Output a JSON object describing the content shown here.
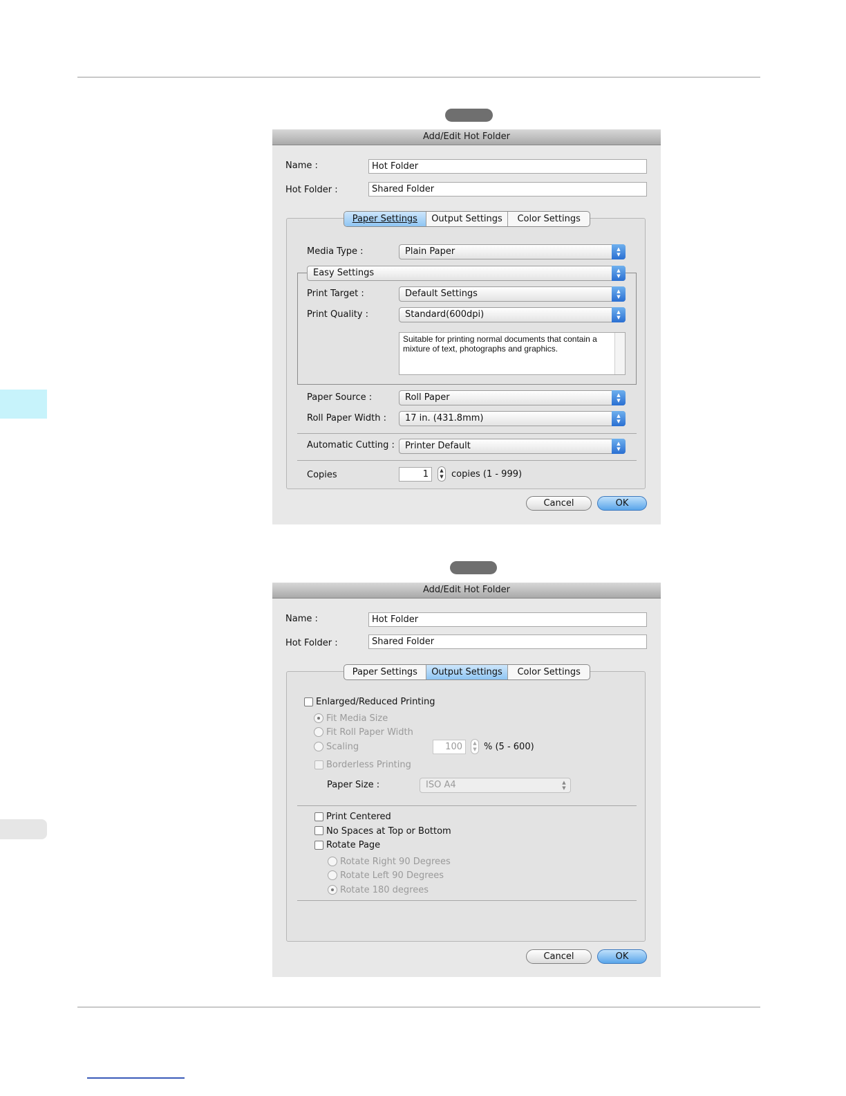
{
  "page": {
    "colors": {
      "rule": "#9a9a9a",
      "side_tab_top": "#c7f3fb",
      "side_tab_bottom": "#e6e6e6",
      "footer_link": "#3a5bb8",
      "pill": "#6f6f6f"
    }
  },
  "dialog1": {
    "title": "Add/Edit Hot Folder",
    "name_label": "Name :",
    "name_value": "Hot Folder",
    "hotfolder_label": "Hot Folder :",
    "hotfolder_value": "Shared Folder",
    "tabs": [
      "Paper Settings",
      "Output Settings",
      "Color Settings"
    ],
    "active_tab": "Paper Settings",
    "media_type_label": "Media Type :",
    "media_type_value": "Plain Paper",
    "easy_settings": "Easy Settings",
    "print_target_label": "Print Target :",
    "print_target_value": "Default Settings",
    "print_quality_label": "Print Quality :",
    "print_quality_value": "Standard(600dpi)",
    "description": "Suitable for printing normal documents that contain a mixture of text, photographs and graphics.",
    "paper_source_label": "Paper Source :",
    "paper_source_value": "Roll Paper",
    "roll_width_label": "Roll Paper Width :",
    "roll_width_value": "17 in. (431.8mm)",
    "auto_cut_label": "Automatic Cutting :",
    "auto_cut_value": "Printer Default",
    "copies_label": "Copies",
    "copies_value": "1",
    "copies_range": "copies (1 - 999)",
    "cancel": "Cancel",
    "ok": "OK"
  },
  "dialog2": {
    "title": "Add/Edit Hot Folder",
    "name_label": "Name :",
    "name_value": "Hot Folder",
    "hotfolder_label": "Hot Folder :",
    "hotfolder_value": "Shared Folder",
    "tabs": [
      "Paper Settings",
      "Output Settings",
      "Color Settings"
    ],
    "active_tab": "Output Settings",
    "enlarged_label": "Enlarged/Reduced Printing",
    "fit_media": "Fit Media Size",
    "fit_roll": "Fit Roll Paper Width",
    "scaling": "Scaling",
    "scaling_value": "100",
    "scaling_range": "% (5 - 600)",
    "borderless": "Borderless Printing",
    "paper_size_label": "Paper Size :",
    "paper_size_value": "ISO A4",
    "print_centered": "Print Centered",
    "no_spaces": "No Spaces at Top or Bottom",
    "rotate_page": "Rotate Page",
    "rotate_right": "Rotate Right 90 Degrees",
    "rotate_left": "Rotate Left 90 Degrees",
    "rotate_180": "Rotate 180 degrees",
    "cancel": "Cancel",
    "ok": "OK"
  }
}
